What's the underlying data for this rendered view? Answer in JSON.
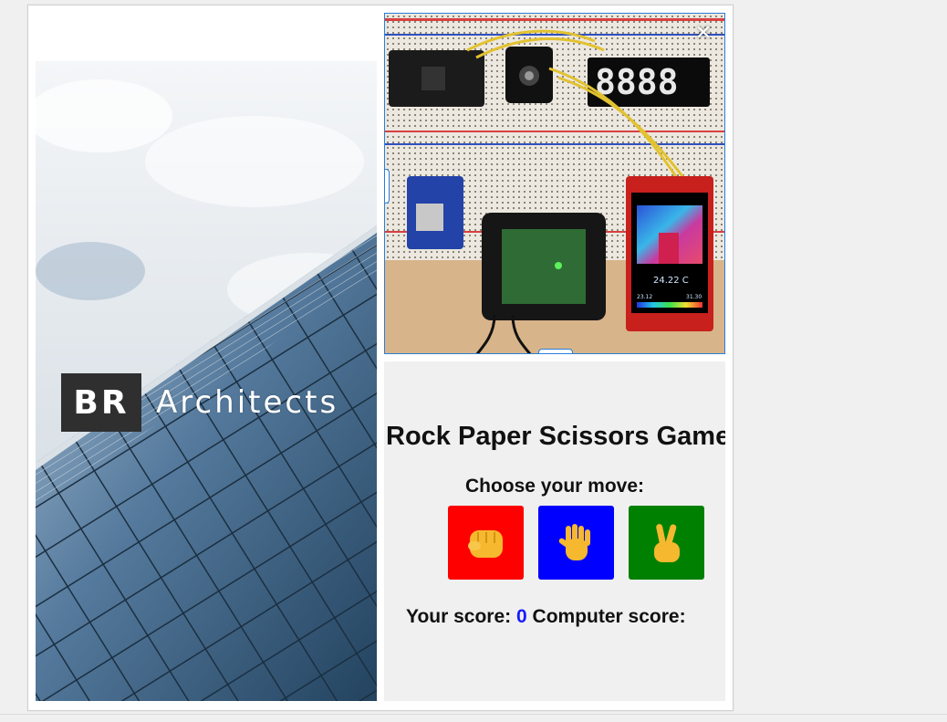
{
  "left_image": {
    "brand_mark": "BR",
    "brand_word": "Architects"
  },
  "right_image": {
    "close_label": "✕",
    "display_digits": "8888",
    "screen_text": "24.22 C",
    "screen_low": "23.12",
    "screen_high": "31.30"
  },
  "game": {
    "title": "Rock Paper Scissors Game",
    "prompt": "Choose your move:",
    "moves": [
      {
        "name": "rock",
        "color": "#ff0000",
        "icon": "fist-icon"
      },
      {
        "name": "paper",
        "color": "#0000ff",
        "icon": "open-hand-icon"
      },
      {
        "name": "scissors",
        "color": "#008000",
        "icon": "victory-hand-icon"
      }
    ],
    "score_label": "Your score:",
    "your_score": "0",
    "computer_label": "Computer score:"
  },
  "colors": {
    "selection_border": "#2b7fd6",
    "score_number": "#1a1aff"
  }
}
